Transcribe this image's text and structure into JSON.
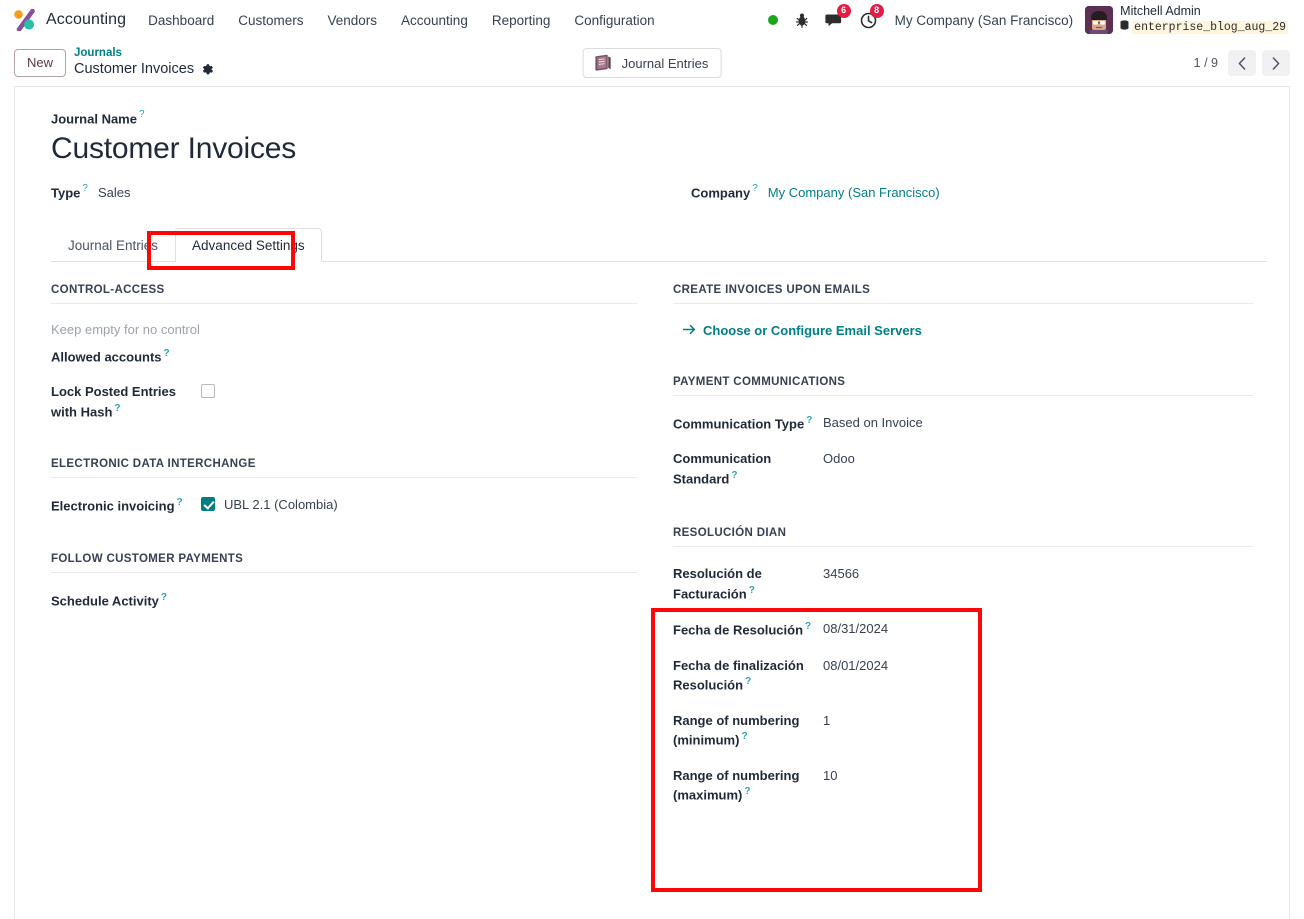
{
  "navbar": {
    "brand": "Accounting",
    "logo_icon": "odoo-accounting-logo",
    "menu": [
      {
        "label": "Dashboard"
      },
      {
        "label": "Customers"
      },
      {
        "label": "Vendors"
      },
      {
        "label": "Accounting"
      },
      {
        "label": "Reporting"
      },
      {
        "label": "Configuration"
      }
    ],
    "status_dot": "online-indicator",
    "bug_icon": "bug-icon",
    "messages_icon": "messages-icon",
    "messages_count": "6",
    "activities_icon": "clock-activities-icon",
    "activities_count": "8",
    "company": "My Company (San Francisco)",
    "user_name": "Mitchell Admin",
    "database_icon": "database-icon",
    "database": "enterprise_blog_aug_29",
    "avatar_icon": "user-avatar"
  },
  "control_panel": {
    "new_button": "New",
    "breadcrumb_parent": "Journals",
    "breadcrumb_current": "Customer Invoices",
    "gear_icon": "gear-icon",
    "smart_button": {
      "label": "Journal Entries",
      "icon": "book-icon"
    },
    "pager": {
      "text": "1 / 9",
      "prev_icon": "chevron-left-icon",
      "next_icon": "chevron-right-icon"
    }
  },
  "form": {
    "journal_name_label": "Journal Name",
    "journal_name_value": "Customer Invoices",
    "type_label": "Type",
    "type_value": "Sales",
    "company_label": "Company",
    "company_value": "My Company (San Francisco)",
    "help_marker": "?"
  },
  "tabs": [
    {
      "label": "Journal Entries",
      "active": false
    },
    {
      "label": "Advanced Settings",
      "active": true
    }
  ],
  "settings": {
    "control_access": {
      "title": "CONTROL-ACCESS",
      "note": "Keep empty for no control",
      "allowed_accounts_label": "Allowed accounts",
      "allowed_accounts_value": "",
      "lock_label": "Lock Posted Entries with Hash",
      "lock_checked": false
    },
    "edi": {
      "title": "ELECTRONIC DATA INTERCHANGE",
      "electronic_invoicing_label": "Electronic invoicing",
      "ubl_label": "UBL 2.1 (Colombia)",
      "ubl_checked": true
    },
    "follow_payments": {
      "title": "FOLLOW CUSTOMER PAYMENTS",
      "schedule_activity_label": "Schedule Activity",
      "schedule_activity_value": ""
    },
    "create_invoices_emails": {
      "title": "CREATE INVOICES UPON EMAILS",
      "link_label": "Choose or Configure Email Servers",
      "link_icon": "arrow-right-icon"
    },
    "payment_communications": {
      "title": "PAYMENT COMMUNICATIONS",
      "communication_type_label": "Communication Type",
      "communication_type_value": "Based on Invoice",
      "communication_standard_label": "Communication Standard",
      "communication_standard_value": "Odoo"
    },
    "resolucion_dian": {
      "title": "RESOLUCIÓN DIAN",
      "fields": [
        {
          "label": "Resolución de Facturación",
          "value": "34566"
        },
        {
          "label": "Fecha de Resolución",
          "value": "08/31/2024"
        },
        {
          "label": "Fecha de finalización Resolución",
          "value": "08/01/2024"
        },
        {
          "label": "Range of numbering (minimum)",
          "value": "1"
        },
        {
          "label": "Range of numbering (maximum)",
          "value": "10"
        }
      ]
    }
  },
  "annotations": [
    {
      "name": "advanced-settings-tab-highlight",
      "color": "#fb0707"
    },
    {
      "name": "resolucion-dian-highlight",
      "color": "#fb0707"
    }
  ],
  "colors": {
    "accent": "#017e84",
    "badge": "#e11d48",
    "annotation": "#fb0707",
    "help": "#2ea3ab"
  }
}
